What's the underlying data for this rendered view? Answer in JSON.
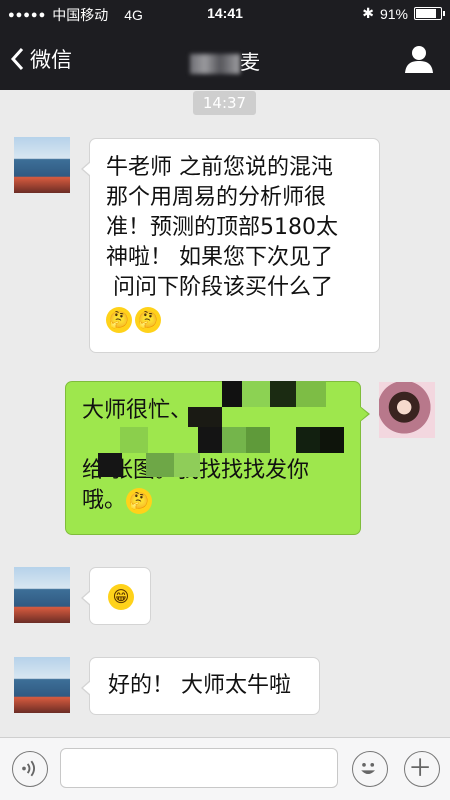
{
  "status": {
    "carrier": "中国移动",
    "network": "4G",
    "time": "14:41",
    "battery": "91%",
    "battery_level": 0.91
  },
  "nav": {
    "back_label": "微信",
    "title_visible_char": "麦"
  },
  "timestamp": "14:37",
  "messages": [
    {
      "side": "left",
      "text": "牛老师 之前您说的混沌\n那个用周易的分析师很\n准！预测的顶部5180太\n神啦！ 如果您下次见了\n 问问下阶段该买什么了",
      "emoji": [
        "think",
        "think"
      ]
    },
    {
      "side": "right",
      "line1": "大师很忙、",
      "line3": "给   张图。我找找找发你",
      "line4": "哦。",
      "emoji": [
        "think"
      ]
    },
    {
      "side": "left",
      "emoji": [
        "grin"
      ]
    },
    {
      "side": "left",
      "text": "好的！ 大师太牛啦"
    }
  ],
  "icons": {
    "back": "chevron-left-icon",
    "profile": "person-icon",
    "voice": "voice-icon",
    "emoji": "smile-icon",
    "add": "plus-icon"
  }
}
